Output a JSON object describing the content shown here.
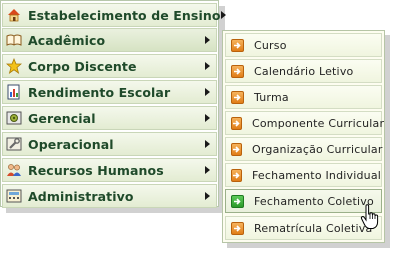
{
  "main_menu": {
    "items": [
      {
        "label": "Estabelecimento de Ensino",
        "icon": "house-icon"
      },
      {
        "label": "Acadêmico",
        "icon": "open-book-icon"
      },
      {
        "label": "Corpo Discente",
        "icon": "star-icon"
      },
      {
        "label": "Rendimento Escolar",
        "icon": "report-icon"
      },
      {
        "label": "Gerencial",
        "icon": "gear-icon"
      },
      {
        "label": "Operacional",
        "icon": "tools-icon"
      },
      {
        "label": "Recursos Humanos",
        "icon": "people-icon"
      },
      {
        "label": "Administrativo",
        "icon": "calculator-icon"
      }
    ],
    "active_index": 1
  },
  "sub_menu": {
    "items": [
      {
        "label": "Curso"
      },
      {
        "label": "Calendário Letivo"
      },
      {
        "label": "Turma"
      },
      {
        "label": "Componente Curricular"
      },
      {
        "label": "Organização Curricular"
      },
      {
        "label": "Fechamento Individual"
      },
      {
        "label": "Fechamento Coletivo"
      },
      {
        "label": "Rematrícula Coletiva"
      }
    ],
    "hover_index": 6
  },
  "colors": {
    "menu_text": "#1f4a2a",
    "submenu_icon_orange": "#e07d17",
    "submenu_icon_hover_green": "#2b9a2a"
  }
}
